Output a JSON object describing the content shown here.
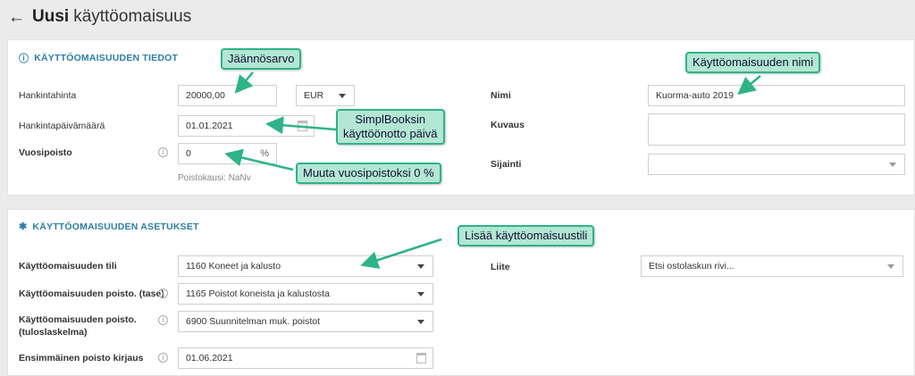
{
  "header": {
    "title_bold": "Uusi",
    "title_rest": "käyttöomaisuus",
    "back_icon": "arrow-left-icon"
  },
  "details": {
    "section_title": "KÄYTTÖOMAISUUDEN TIEDOT",
    "section_icon": "info-circle-icon",
    "purchase_price_label": "Hankintahinta",
    "purchase_price_value": "20000,00",
    "currency_value": "EUR",
    "purchase_date_label": "Hankintapäivämäärä",
    "purchase_date_value": "01.01.2021",
    "depreciation_label": "Vuosipoisto",
    "depreciation_value": "0",
    "depreciation_unit": "%",
    "depreciation_period": "Poistokausi: NaNv",
    "name_label": "Nimi",
    "name_value": "Kuorma-auto 2019",
    "description_label": "Kuvaus",
    "description_value": "",
    "location_label": "Sijainti",
    "location_value": ""
  },
  "settings": {
    "section_title": "KÄYTTÖOMAISUUDEN ASETUKSET",
    "section_icon": "gear-icon",
    "asset_account_label": "Käyttöomaisuuden tili",
    "asset_account_value": "1160 Koneet ja kalusto",
    "depr_balance_label": "Käyttöomaisuuden poisto. (tase)",
    "depr_balance_value": "1165 Poistot koneista ja kalustosta",
    "depr_income_label_1": "Käyttöomaisuuden poisto.",
    "depr_income_label_2": "(tuloslaskelma)",
    "depr_income_value": "6900 Suunnitelman muk. poistot",
    "first_entry_label": "Ensimmäinen poisto kirjaus",
    "first_entry_value": "01.06.2021",
    "attachment_label": "Liite",
    "attachment_placeholder": "Etsi ostolaskun rivi..."
  },
  "annotations": {
    "residual": "Jäännösarvo",
    "asset_name": "Käyttöomaisuuden nimi",
    "simplbooks_1": "SimplBooksin",
    "simplbooks_2": "käyttöönotto päivä",
    "zero_depr": "Muuta vuosipoistoksi 0 %",
    "add_account": "Lisää käyttöomaisuustili"
  },
  "colors": {
    "accent": "#2b7ea6",
    "callout_bg": "#b3e6d3",
    "callout_border": "#2eb389"
  }
}
